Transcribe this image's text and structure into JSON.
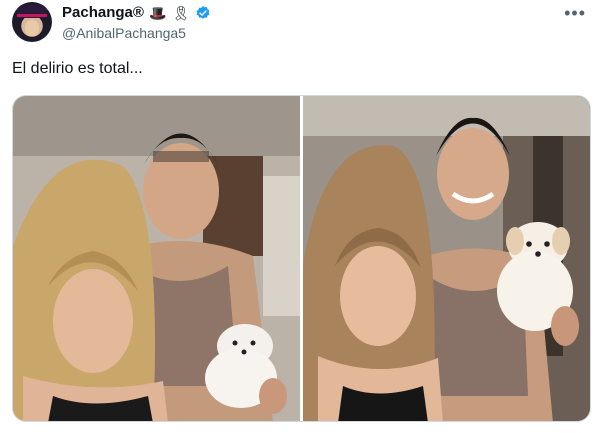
{
  "author": {
    "display_name": "Pachanga®",
    "handle": "@AnibalPachanga5",
    "badges": [
      "top-hat-icon",
      "ribbon-icon",
      "verified-icon"
    ],
    "verified_color": "#1d9bf0"
  },
  "tweet": {
    "text": "El delirio es total..."
  },
  "media": {
    "photos": [
      {
        "icon": "photo-couple-with-puppy-1"
      },
      {
        "icon": "photo-couple-with-puppy-2"
      }
    ]
  },
  "menu": {
    "more_icon": "more-options-icon"
  }
}
